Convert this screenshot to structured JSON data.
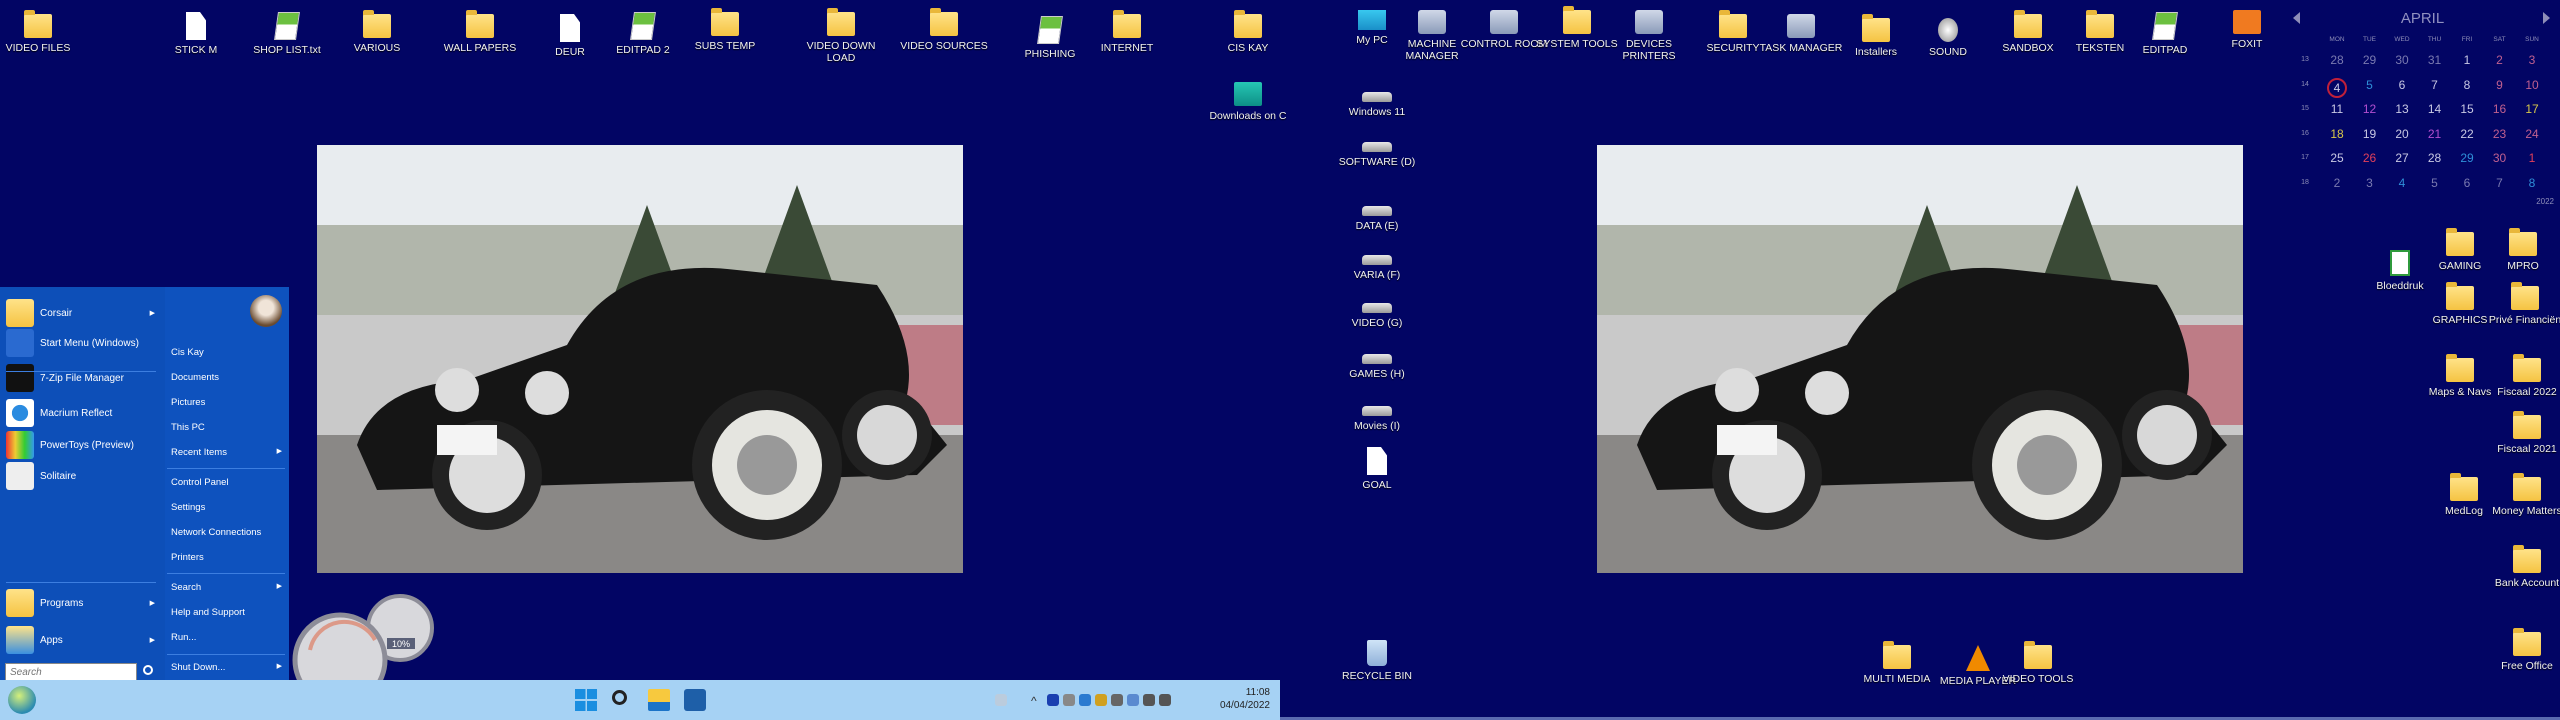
{
  "left_monitor": {
    "desktop_icons": [
      {
        "label": "VIDEO FILES",
        "icon": "folder"
      },
      {
        "label": "STICK M",
        "icon": "document"
      },
      {
        "label": "SHOP LIST.txt",
        "icon": "editpad"
      },
      {
        "label": "VARIOUS",
        "icon": "folder"
      },
      {
        "label": "WALL PAPERS",
        "icon": "folder"
      },
      {
        "label": "DEUR",
        "icon": "document"
      },
      {
        "label": "EDITPAD 2",
        "icon": "editpad"
      },
      {
        "label": "SUBS TEMP",
        "icon": "folder"
      },
      {
        "label": "VIDEO DOWN LOAD",
        "icon": "folder"
      },
      {
        "label": "VIDEO SOURCES",
        "icon": "folder"
      },
      {
        "label": "PHISHING",
        "icon": "editpad"
      },
      {
        "label": "INTERNET",
        "icon": "folder"
      },
      {
        "label": "CIS KAY",
        "icon": "folder"
      },
      {
        "label": "Downloads on C",
        "icon": "download"
      }
    ],
    "start_menu": {
      "pinned": [
        {
          "label": "Corsair",
          "icon": "folder",
          "submenu": true
        },
        {
          "label": "Start Menu (Windows)",
          "icon": "startmenu",
          "submenu": false
        },
        {
          "label": "7-Zip File Manager",
          "icon": "7zip",
          "submenu": false
        },
        {
          "label": "Macrium Reflect",
          "icon": "macrium",
          "submenu": false
        },
        {
          "label": "PowerToys (Preview)",
          "icon": "powertoys",
          "submenu": false
        },
        {
          "label": "Solitaire",
          "icon": "solitaire",
          "submenu": false
        }
      ],
      "bottom": [
        {
          "label": "Programs",
          "icon": "programs",
          "submenu": true
        },
        {
          "label": "Apps",
          "icon": "apps",
          "submenu": true
        }
      ],
      "search_placeholder": "Search",
      "right_items": [
        {
          "label": "Cis Kay",
          "submenu": false
        },
        {
          "label": "Documents",
          "submenu": false
        },
        {
          "label": "Pictures",
          "submenu": false
        },
        {
          "label": "This PC",
          "submenu": false
        },
        {
          "label": "Recent Items",
          "submenu": true
        },
        {
          "label": "Control Panel",
          "submenu": false
        },
        {
          "label": "Settings",
          "submenu": false
        },
        {
          "label": "Network Connections",
          "submenu": false
        },
        {
          "label": "Printers",
          "submenu": false
        },
        {
          "label": "Search",
          "submenu": true
        },
        {
          "label": "Help and Support",
          "submenu": false
        },
        {
          "label": "Run...",
          "submenu": false
        },
        {
          "label": "Shut Down...",
          "submenu": true
        }
      ]
    },
    "gadget": {
      "gauge_small_label": "10%"
    },
    "taskbar": {
      "pinned": [
        "windows-start",
        "search",
        "file-explorer",
        "microsoft-store"
      ],
      "tray": [
        "recycle",
        "chevron-up",
        "malwarebytes",
        "antivirus",
        "defender",
        "bug",
        "usb",
        "device",
        "network",
        "volume"
      ],
      "time": "11:08",
      "date": "04/04/2022"
    }
  },
  "right_monitor": {
    "desktop_icons": [
      {
        "label": "My  PC",
        "icon": "monitor"
      },
      {
        "label": "MACHINE MANAGER",
        "icon": "generic"
      },
      {
        "label": "CONTROL ROOM",
        "icon": "generic"
      },
      {
        "label": "SYSTEM TOOLS",
        "icon": "folder"
      },
      {
        "label": "DEVICES PRINTERS",
        "icon": "generic"
      },
      {
        "label": "SECURITY",
        "icon": "folder"
      },
      {
        "label": "TASK MANAGER",
        "icon": "generic"
      },
      {
        "label": "Installers",
        "icon": "folder"
      },
      {
        "label": "SOUND",
        "icon": "sound"
      },
      {
        "label": "SANDBOX",
        "icon": "folder"
      },
      {
        "label": "TEKSTEN",
        "icon": "folder"
      },
      {
        "label": "EDITPAD",
        "icon": "editpad"
      },
      {
        "label": "FOXIT",
        "icon": "foxit"
      },
      {
        "label": "Windows 11",
        "icon": "drive"
      },
      {
        "label": "SOFTWARE (D)",
        "icon": "drive"
      },
      {
        "label": "DATA (E)",
        "icon": "drive"
      },
      {
        "label": "VARIA (F)",
        "icon": "drive"
      },
      {
        "label": "VIDEO (G)",
        "icon": "drive"
      },
      {
        "label": "GAMES (H)",
        "icon": "drive"
      },
      {
        "label": "Movies (I)",
        "icon": "drive"
      },
      {
        "label": "GOAL",
        "icon": "document"
      },
      {
        "label": "RECYCLE BIN",
        "icon": "recycle"
      },
      {
        "label": "Bloeddruk",
        "icon": "spreadsheet"
      },
      {
        "label": "GAMING",
        "icon": "folder"
      },
      {
        "label": "MPRO",
        "icon": "folder"
      },
      {
        "label": "GRAPHICS",
        "icon": "folder"
      },
      {
        "label": "Privé Financiën",
        "icon": "folder"
      },
      {
        "label": "Maps & Navs",
        "icon": "folder"
      },
      {
        "label": "Fiscaal 2022",
        "icon": "folder"
      },
      {
        "label": "Fiscaal 2021",
        "icon": "folder"
      },
      {
        "label": "MedLog",
        "icon": "folder"
      },
      {
        "label": "Money Matters",
        "icon": "folder"
      },
      {
        "label": "Bank Account",
        "icon": "folder"
      },
      {
        "label": "Free Office",
        "icon": "folder"
      },
      {
        "label": "MULTI MEDIA",
        "icon": "folder"
      },
      {
        "label": "MEDIA PLAYER",
        "icon": "vlc"
      },
      {
        "label": "VIDEO TOOLS",
        "icon": "folder"
      }
    ],
    "calendar": {
      "month": "APRIL",
      "year": "2022",
      "weekday_headers": [
        "MON",
        "TUE",
        "WED",
        "THU",
        "FRI",
        "SAT",
        "SUN"
      ],
      "weeks": [
        {
          "num": "13",
          "days": [
            "28",
            "29",
            "30",
            "31",
            "1",
            "2",
            "3"
          ]
        },
        {
          "num": "14",
          "days": [
            "4",
            "5",
            "6",
            "7",
            "8",
            "9",
            "10"
          ]
        },
        {
          "num": "15",
          "days": [
            "11",
            "12",
            "13",
            "14",
            "15",
            "16",
            "17"
          ]
        },
        {
          "num": "16",
          "days": [
            "18",
            "19",
            "20",
            "21",
            "22",
            "23",
            "24"
          ]
        },
        {
          "num": "17",
          "days": [
            "25",
            "26",
            "27",
            "28",
            "29",
            "30",
            "1"
          ]
        },
        {
          "num": "18",
          "days": [
            "2",
            "3",
            "4",
            "5",
            "6",
            "7",
            "8"
          ]
        }
      ],
      "today": "4",
      "colors": {
        "default": "#c9c9e4",
        "weekend": "#c0608f",
        "blue": "#2f8fd8",
        "purple": "#b34fd0",
        "yellow": "#d8c84a",
        "red": "#e2405a",
        "dim": "#7a7ab0"
      }
    }
  }
}
